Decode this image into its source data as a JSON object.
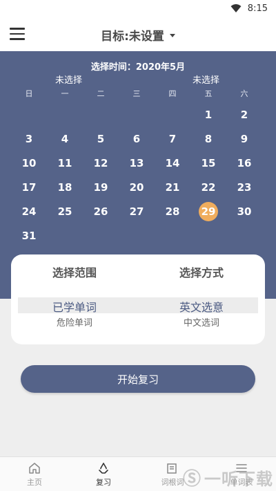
{
  "status_bar": {
    "time": "8:15",
    "wifi_icon": "wifi-icon"
  },
  "app_bar": {
    "menu_icon": "hamburger-icon",
    "goal_label": "目标:未设置",
    "dropdown_icon": "caret-down-icon"
  },
  "calendar": {
    "title": "选择时间：2020年5月",
    "unselected_label_1": "未选择",
    "unselected_label_2": "未选择",
    "weekdays": [
      "日",
      "一",
      "二",
      "三",
      "四",
      "五",
      "六"
    ],
    "weeks": [
      [
        "",
        "",
        "",
        "",
        "",
        "1",
        "2"
      ],
      [
        "3",
        "4",
        "5",
        "6",
        "7",
        "8",
        "9"
      ],
      [
        "10",
        "11",
        "12",
        "13",
        "14",
        "15",
        "16"
      ],
      [
        "17",
        "18",
        "19",
        "20",
        "21",
        "22",
        "23"
      ],
      [
        "24",
        "25",
        "26",
        "27",
        "28",
        "29",
        "30"
      ],
      [
        "31",
        "",
        "",
        "",
        "",
        "",
        ""
      ]
    ],
    "today": "29",
    "today_color": "#f0ad5d",
    "panel_color": "#556389"
  },
  "chooser": {
    "range_header": "选择范围",
    "method_header": "选择方式",
    "range_selected": "已学单词",
    "range_next": "危险单词",
    "method_selected": "英文选意",
    "method_next": "中文选词"
  },
  "start_button": {
    "label": "开始复习"
  },
  "bottom_nav": {
    "items": [
      {
        "label": "主页",
        "icon": "home-icon"
      },
      {
        "label": "复习",
        "icon": "recycle-icon"
      },
      {
        "label": "词根词",
        "icon": "book-icon"
      },
      {
        "label": "单词表",
        "icon": "list-icon"
      }
    ],
    "active": "复习"
  },
  "watermark": {
    "text": "一听下载"
  }
}
